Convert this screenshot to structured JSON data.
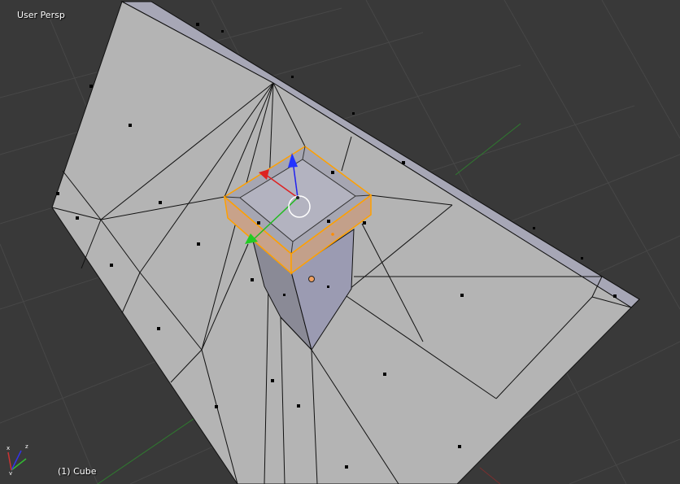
{
  "viewport": {
    "view_label": "User Persp",
    "object_label": "(1) Cube",
    "background": "#393939"
  },
  "colors": {
    "mesh_face": "#b5b5b5",
    "mesh_face_dark": "#a4a4b4",
    "selected_edge": "#ffa000",
    "grid": "#484848",
    "x_axis": "#cc3333",
    "y_axis": "#33bb33",
    "z_axis": "#3333ee"
  },
  "gizmo_axes": [
    "x",
    "y",
    "z"
  ],
  "icons": {
    "axis_gizmo": "axis-orientation-icon",
    "cursor": "3d-cursor-icon",
    "origin": "object-origin-icon"
  }
}
